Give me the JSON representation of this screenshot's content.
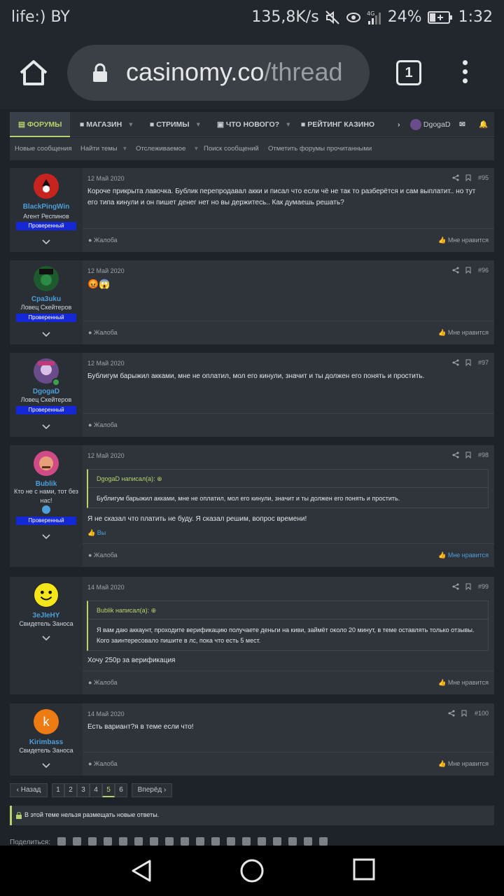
{
  "status": {
    "carrier": "life:) BY",
    "speed": "135,8K/s",
    "battery": "24%",
    "time": "1:32",
    "net": "4G"
  },
  "browser": {
    "url_host": "casinomy.co",
    "url_path": "/thread",
    "tab_count": "1"
  },
  "nav": {
    "items": [
      {
        "label": "ФОРУМЫ",
        "icon": "chat-icon"
      },
      {
        "label": "МАГАЗИН",
        "icon": "folder-icon"
      },
      {
        "label": "СТРИМЫ",
        "icon": "folder-icon"
      },
      {
        "label": "ЧТО НОВОГО?",
        "icon": "comment-icon"
      },
      {
        "label": "РЕЙТИНГ КАЗИНО",
        "icon": "folder-icon"
      }
    ],
    "username": "DgogaD"
  },
  "subnav": [
    "Новые сообщения",
    "Найти темы",
    "Отслеживаемое",
    "Поиск сообщений",
    "Отметить форумы прочитанными"
  ],
  "posts": [
    {
      "user": "BlackPingWin",
      "title": "Агент Респинов",
      "badge": "Проверенный",
      "date": "12 Май 2020",
      "num": "#95",
      "text": "Короче прикрыта лавочка. Бублик перепродавал акки и писал что если чё не так то разберётся и сам выплатит.. но тут его типа кинули и он пишет денег нет но вы держитесь.. Как думаешь решать?",
      "report": "Жалоба",
      "like": "Мне нравится"
    },
    {
      "user": "Cpa3uku",
      "title": "Ловец Скейтеров",
      "badge": "Проверенный",
      "date": "12 Май 2020",
      "num": "#96",
      "text": "😡😱",
      "report": "Жалоба",
      "like": "Мне нравится"
    },
    {
      "user": "DgogaD",
      "title": "Ловец Скейтеров",
      "badge": "Проверенный",
      "date": "12 Май 2020",
      "num": "#97",
      "text": "Бублигум барыжил акками, мне не оплатил, мол его кинули, значит и ты должен его понять и простить.",
      "report": "Жалоба",
      "like": ""
    },
    {
      "user": "Bublik",
      "title": "Кто не с нами, тот без нас!",
      "badge": "Проверенный",
      "date": "12 Май 2020",
      "num": "#98",
      "quote_head": "DgogaD написал(а): ⊕",
      "quote": "Бублигум барыжил акками, мне не оплатил, мол его кинули, значит и ты должен его понять и простить.",
      "text": "Я не сказал что платить не буду. Я сказал решим, вопрос времени!",
      "liked_by": "Вы",
      "report": "Жалоба",
      "like": "Мне нравится"
    },
    {
      "user": "3eJIeHY",
      "title": "Свидетель Заноса",
      "badge": "",
      "date": "14 Май 2020",
      "num": "#99",
      "quote_head": "Bublik написал(а): ⊕",
      "quote": "Я вам даю аккаунт, проходите верификацию получаете деньги на киви, займёт около 20 минут, в теме оставлять только отзывы. Кого заинтересовало пишите в лс, пока что есть 5 мест.",
      "text": "Хочу 250р за верификация",
      "report": "Жалоба",
      "like": "Мне нравится"
    },
    {
      "user": "Kirimbass",
      "title": "Свидетель Заноса",
      "badge": "",
      "date": "14 Май 2020",
      "num": "#100",
      "avatar_letter": "k",
      "text": "Есть вариант?я в теме если что!",
      "report": "Жалоба",
      "like": "Мне нравится"
    }
  ],
  "pager": {
    "prev": "‹ Назад",
    "pages": [
      "1",
      "2",
      "3",
      "4",
      "5",
      "6"
    ],
    "current": "5",
    "next": "Вперёд ›"
  },
  "closed_notice": "В этой теме нельзя размещать новые ответы.",
  "share_label": "Поделиться:",
  "colors": {
    "accent": "#b7d36c",
    "link": "#4d9fd8",
    "badge": "#1528d8",
    "bg": "#1e2229"
  }
}
